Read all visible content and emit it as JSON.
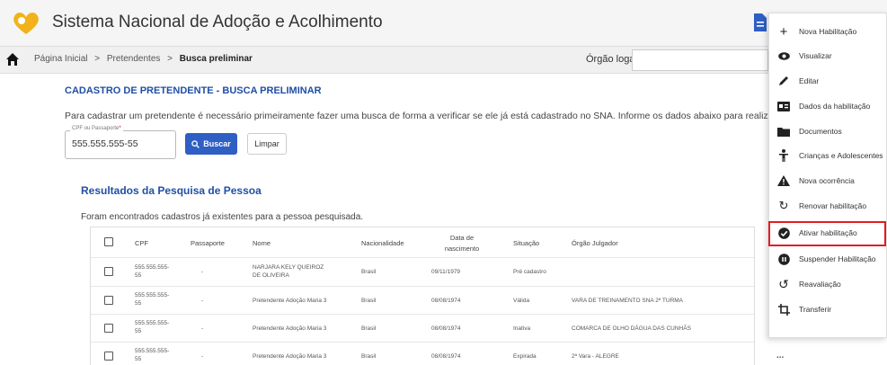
{
  "header": {
    "app_title": "Sistema Nacional de Adoção e Acolhimento",
    "icons": [
      "heart-logo",
      "document-icon",
      "home-icon"
    ]
  },
  "breadcrumb": {
    "items": [
      "Página Inicial",
      "Pretendentes",
      "Busca preliminar"
    ],
    "separator": ">"
  },
  "orgao": {
    "label": "Órgão logado",
    "value": ""
  },
  "page": {
    "heading": "CADASTRO DE PRETENDENTE - BUSCA PRELIMINAR",
    "instruction": "Para cadastrar um pretendente é necessário primeiramente fazer uma busca de forma a verificar se ele já está cadastrado no SNA. Informe os dados abaixo para realizar essa pesquisa."
  },
  "search": {
    "field_label": "CPF ou Passaporte",
    "required_mark": "*",
    "field_value": "555.555.555-55",
    "buscar_label": "Buscar",
    "limpar_label": "Limpar"
  },
  "results": {
    "title": "Resultados da Pesquisa de Pessoa",
    "subtitle": "Foram encontrados cadastros já existentes para a pessoa pesquisada.",
    "columns": [
      "CPF",
      "Passaporte",
      "Nome",
      "Nacionalidade",
      "Data de nascimento",
      "Situação",
      "Órgão Julgador"
    ],
    "rows": [
      {
        "cpf": "555.555.555-55",
        "passaporte": "-",
        "nome": "NARJARA KELY QUEIROZ DE OLIVEIRA",
        "nacionalidade": "Brasil",
        "nascimento": "09/11/1979",
        "situacao": "Pré cadastro",
        "orgao": ""
      },
      {
        "cpf": "555.555.555-55",
        "passaporte": "-",
        "nome": "Pretendente Adoção Maria 3",
        "nacionalidade": "Brasil",
        "nascimento": "08/08/1974",
        "situacao": "Válida",
        "orgao": "VARA DE TREINAMENTO SNA 2ª TURMA"
      },
      {
        "cpf": "555.555.555-55",
        "passaporte": "-",
        "nome": "Pretendente Adoção Maria 3",
        "nacionalidade": "Brasil",
        "nascimento": "08/08/1974",
        "situacao": "Inativa",
        "orgao": "COMARCA DE OLHO DÁGUA DAS CUNHÃS"
      },
      {
        "cpf": "555.555.555-55",
        "passaporte": "-",
        "nome": "Pretendente Adoção Maria 3",
        "nacionalidade": "Brasil",
        "nascimento": "08/08/1974",
        "situacao": "Expirada",
        "orgao": "2ª Vara - ALEGRE"
      }
    ],
    "row_action": "..."
  },
  "menu": {
    "items": [
      {
        "label": "Nova Habilitação",
        "icon": "plus-icon"
      },
      {
        "label": "Visualizar",
        "icon": "eye-icon"
      },
      {
        "label": "Editar",
        "icon": "pencil-icon"
      },
      {
        "label": "Dados da habilitação",
        "icon": "id-card-icon"
      },
      {
        "label": "Documentos",
        "icon": "folder-icon"
      },
      {
        "label": "Crianças e Adolescentes",
        "icon": "child-icon"
      },
      {
        "label": "Nova ocorrência",
        "icon": "warning-icon"
      },
      {
        "label": "Renovar habilitação",
        "icon": "refresh-icon"
      },
      {
        "label": "Ativar habilitação",
        "icon": "check-circle-icon",
        "highlighted": true
      },
      {
        "label": "Suspender Habilitação",
        "icon": "pause-circle-icon"
      },
      {
        "label": "Reavaliação",
        "icon": "redo-icon"
      },
      {
        "label": "Transferir",
        "icon": "transfer-icon"
      }
    ]
  },
  "colors": {
    "accent_blue": "#2f5ec4",
    "heading_blue": "#1f4fa6",
    "highlight_red": "#e11d22",
    "logo_yellow": "#f2b21b"
  }
}
